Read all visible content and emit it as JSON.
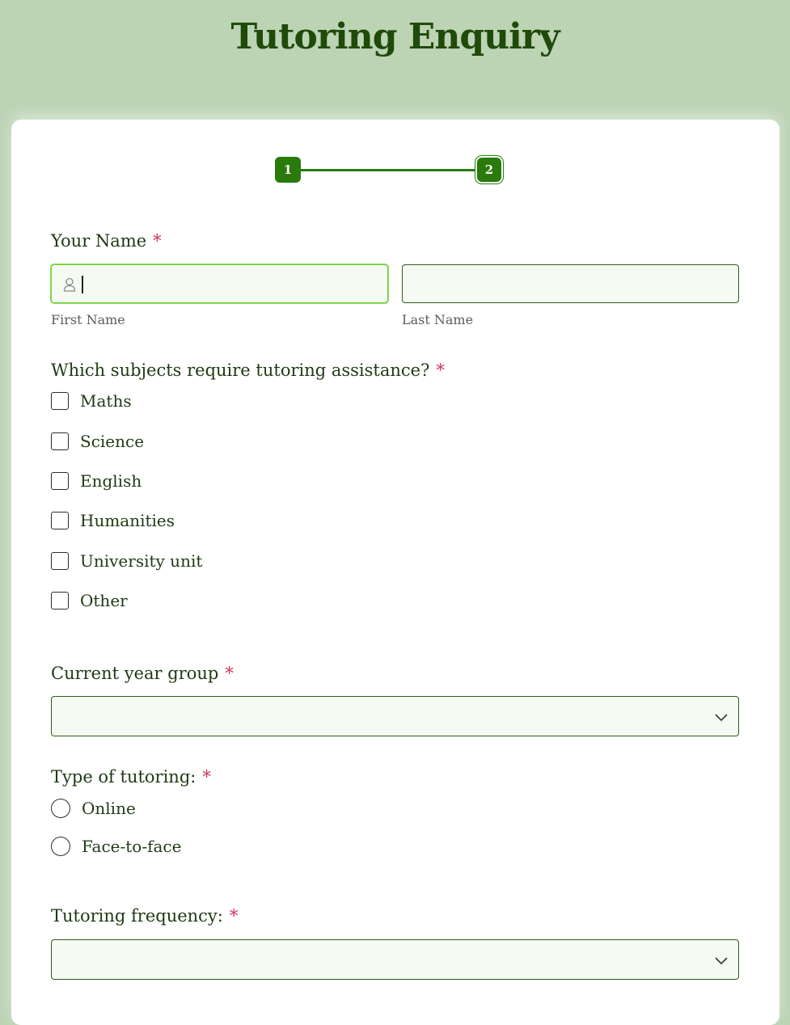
{
  "page": {
    "title": "Tutoring Enquiry"
  },
  "stepper": {
    "steps": [
      "1",
      "2"
    ],
    "current_step": 2
  },
  "name_field": {
    "label": "Your Name",
    "required_mark": "*",
    "first_name": {
      "value": "",
      "sublabel": "First Name"
    },
    "last_name": {
      "value": "",
      "sublabel": "Last Name"
    }
  },
  "subjects": {
    "label": "Which subjects require tutoring assistance?",
    "required_mark": "*",
    "options": [
      "Maths",
      "Science",
      "English",
      "Humanities",
      "University unit",
      "Other"
    ]
  },
  "year_group": {
    "label": "Current year group",
    "required_mark": "*",
    "selected": ""
  },
  "tutoring_type": {
    "label": "Type of tutoring:",
    "required_mark": "*",
    "options": [
      "Online",
      "Face-to-face"
    ]
  },
  "frequency": {
    "label": "Tutoring frequency:",
    "required_mark": "*",
    "selected": ""
  },
  "colors": {
    "background": "#bcd3b4",
    "accent": "#2a7a0c",
    "title": "#1f4a0a",
    "required": "#d2305a",
    "input_bg": "#f5faf2",
    "focus_border": "#6fcf3c"
  },
  "icons": {
    "name_input": "person-icon",
    "dropdown": "chevron-down-icon"
  }
}
